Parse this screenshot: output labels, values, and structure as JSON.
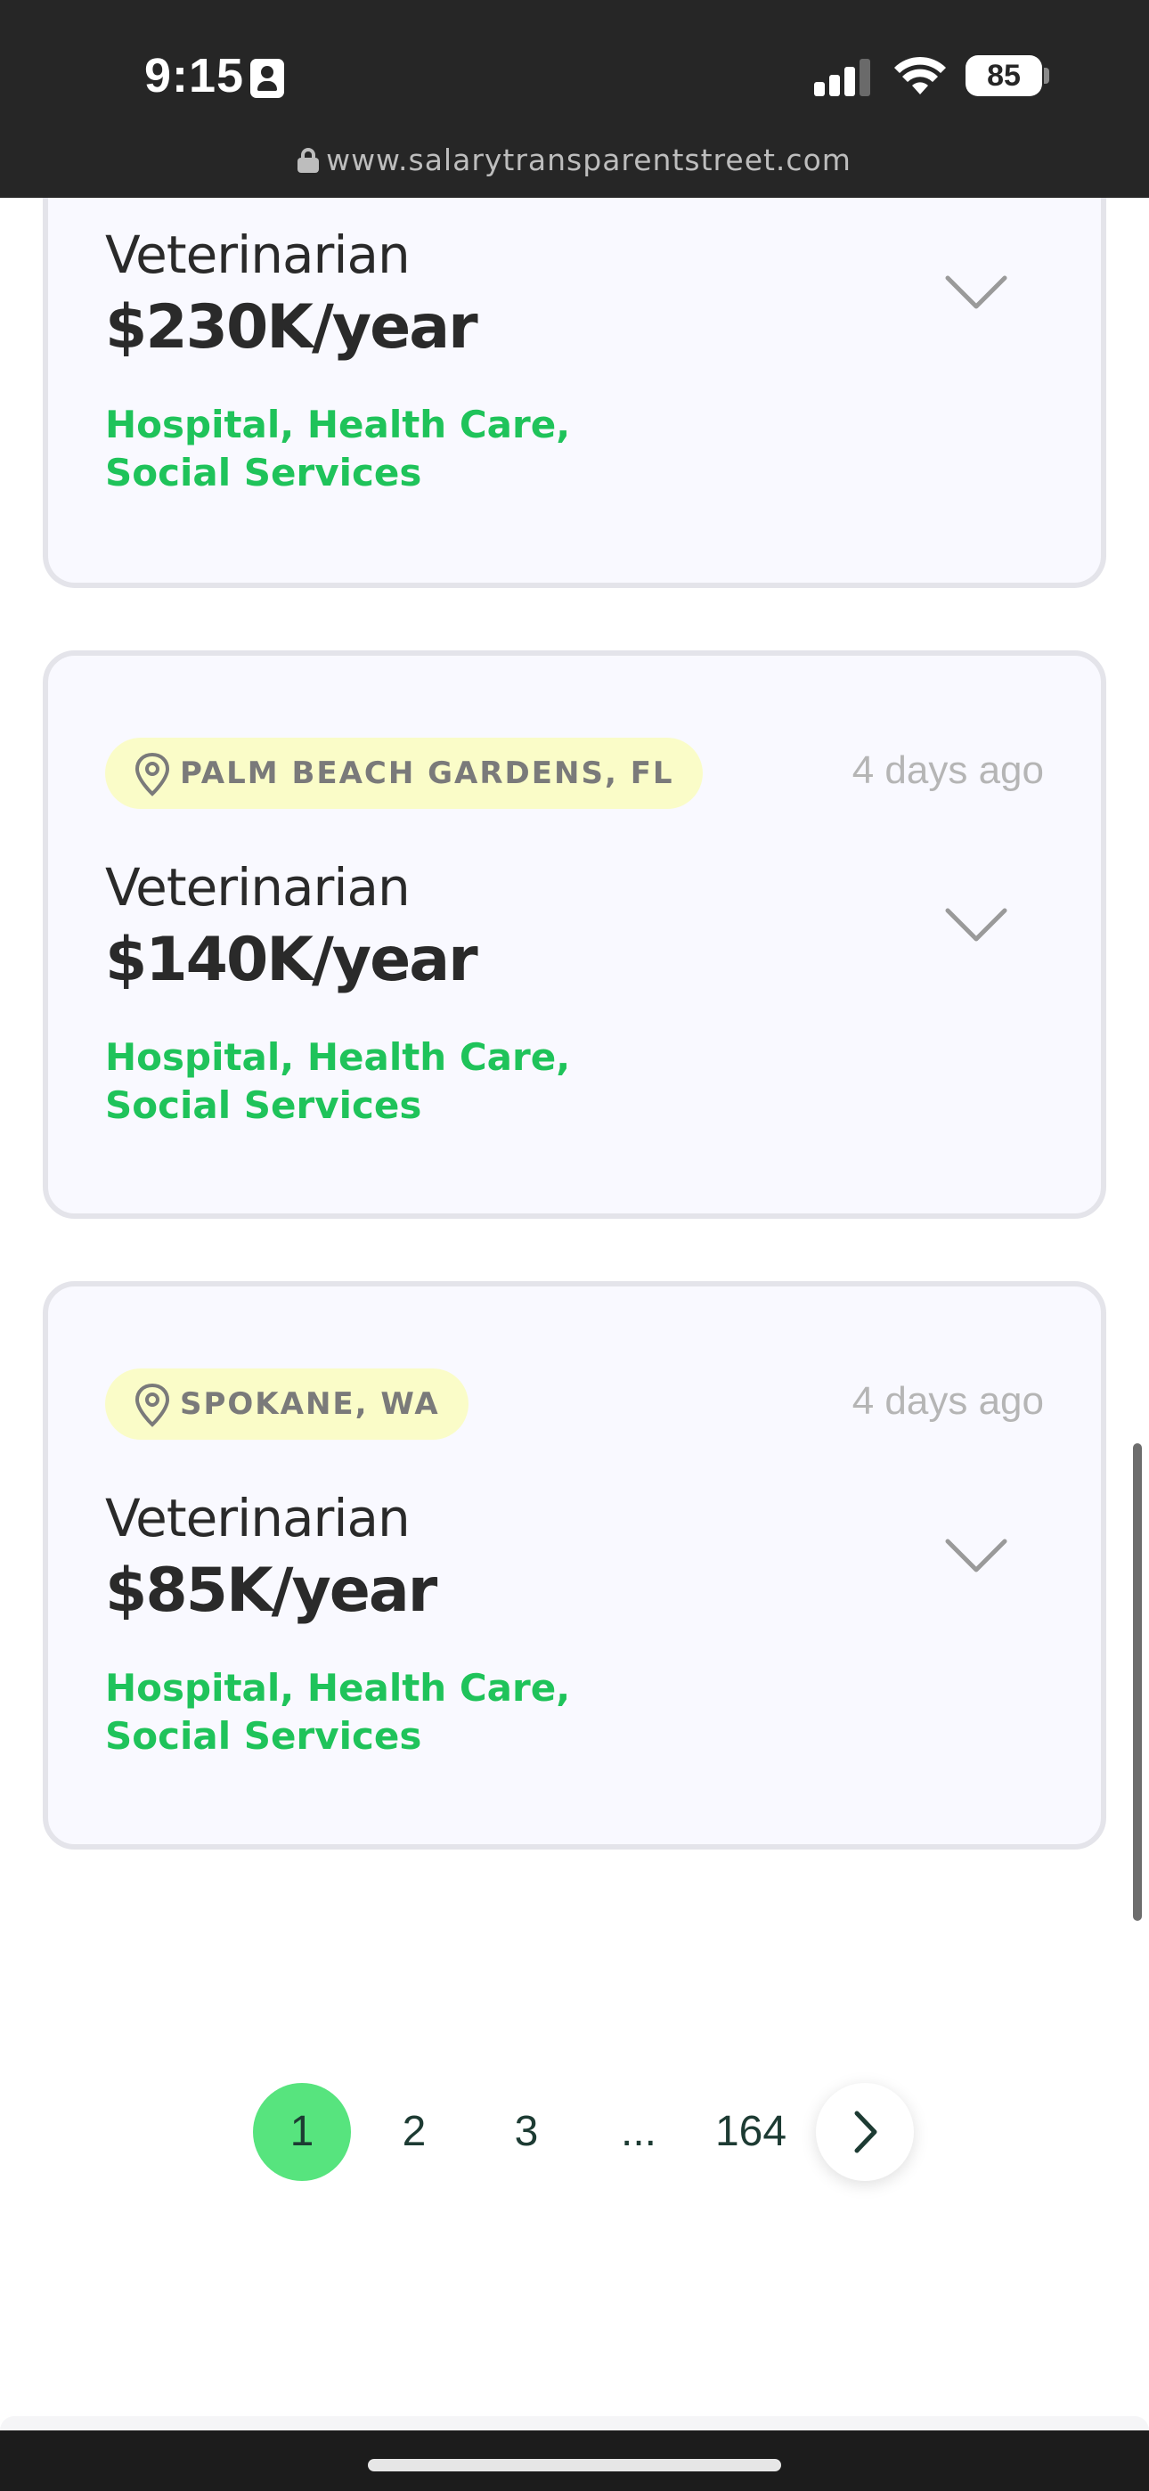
{
  "status_bar": {
    "time": "9:15",
    "battery": "85"
  },
  "browser": {
    "url": "www.salarytransparentstreet.com"
  },
  "listings": [
    {
      "location": "",
      "posted": "",
      "title": "Veterinarian",
      "salary": "$230K/year",
      "industry": "Hospital, Health Care, Social Services"
    },
    {
      "location": "PALM BEACH GARDENS, FL",
      "posted": "4 days ago",
      "title": "Veterinarian",
      "salary": "$140K/year",
      "industry": "Hospital, Health Care, Social Services"
    },
    {
      "location": "SPOKANE, WA",
      "posted": "4 days ago",
      "title": "Veterinarian",
      "salary": "$85K/year",
      "industry": "Hospital, Health Care, Social Services"
    }
  ],
  "pagination": {
    "pages": [
      "1",
      "2",
      "3",
      "...",
      "164"
    ],
    "current": "1"
  },
  "colors": {
    "accent_green": "#1fc35a",
    "active_page": "#57e47e",
    "location_pill": "#fafcc8"
  }
}
